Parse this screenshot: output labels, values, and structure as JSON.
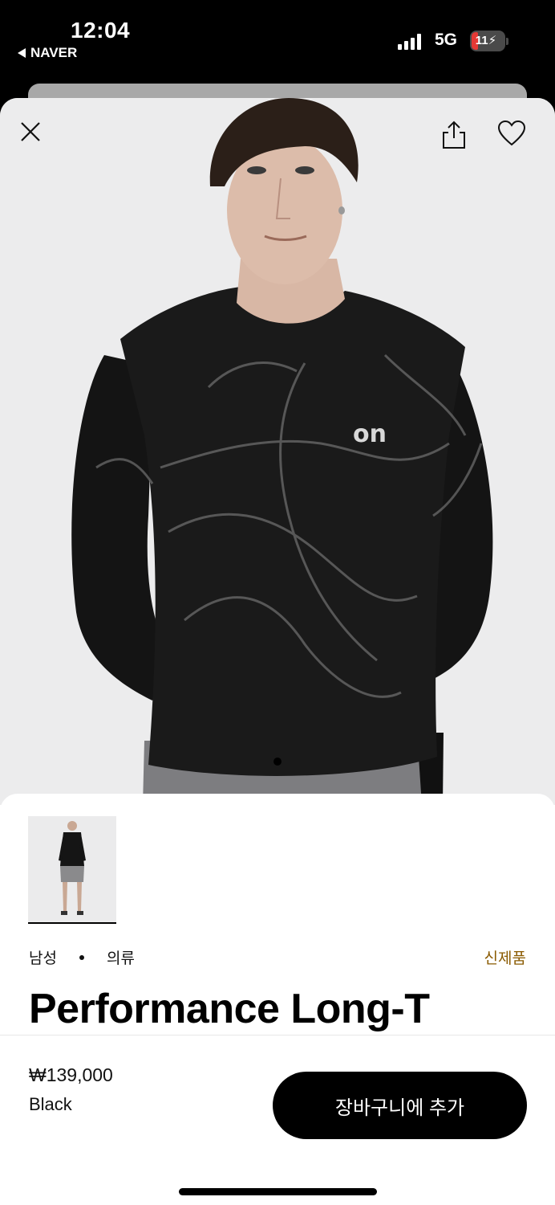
{
  "status_bar": {
    "time": "12:04",
    "back_app": "NAVER",
    "network": "5G",
    "battery": "11"
  },
  "icons": {
    "close": "close-icon",
    "share": "share-icon",
    "favorite": "heart-icon"
  },
  "product": {
    "category_gender": "남성",
    "category_type": "의류",
    "badge": "신제품",
    "title": "Performance Long-T",
    "price": "₩139,000",
    "color": "Black"
  },
  "actions": {
    "add_to_cart": "장바구니에 추가"
  },
  "colors": {
    "badge": "#8a5a00",
    "button": "#000000",
    "hero_background": "#ececed"
  }
}
